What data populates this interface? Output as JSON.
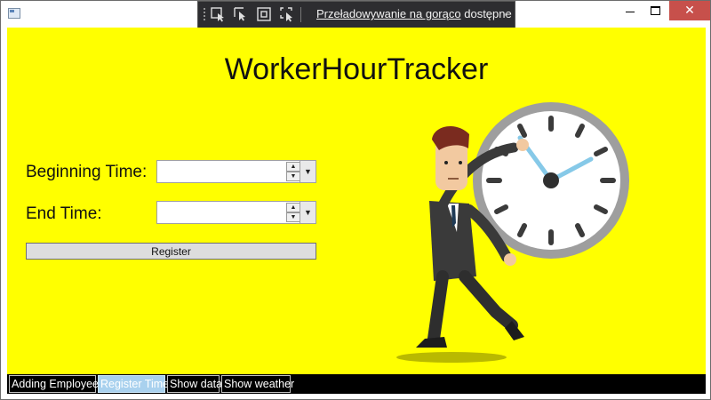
{
  "window": {
    "close_symbol": "✕"
  },
  "debug_toolbar": {
    "link_text": "Przeładowywanie na gorąco",
    "status_text": "dostępne",
    "icons": [
      "select-element-icon",
      "display-layout-adorners-icon",
      "track-focused-element-icon",
      "toggle-selection-icon"
    ]
  },
  "main": {
    "title": "WorkerHourTracker",
    "beginning_time_label": "Beginning Time:",
    "beginning_time_value": "",
    "end_time_label": "End Time:",
    "end_time_value": "",
    "register_label": "Register"
  },
  "nav": {
    "items": [
      {
        "label": "Adding Employee",
        "active": false
      },
      {
        "label": "Register Time",
        "active": true
      },
      {
        "label": "Show data",
        "active": false
      },
      {
        "label": "Show weather",
        "active": false
      }
    ]
  },
  "colors": {
    "background": "#ffff00",
    "nav_bar": "#000000",
    "active_tab": "#a9d1ee",
    "close_button": "#c7504b"
  }
}
